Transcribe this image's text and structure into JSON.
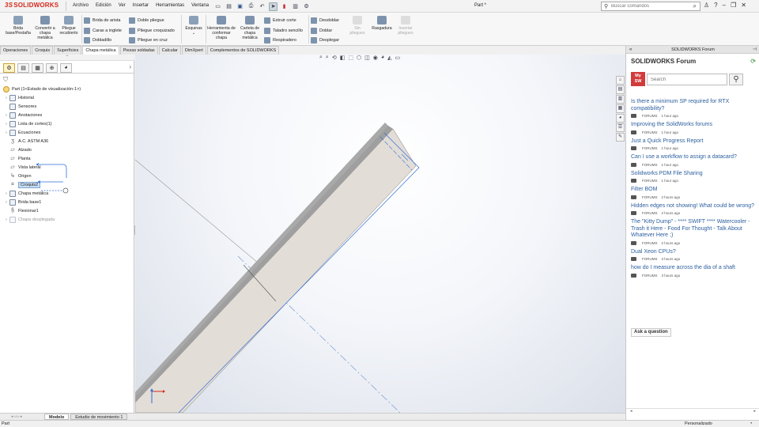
{
  "app": {
    "logo_prefix": "3S",
    "logo_text": "SOLIDWORKS",
    "doc_title": "Part *",
    "search_placeholder": "Buscar comandos"
  },
  "menu": [
    "Archivo",
    "Edición",
    "Ver",
    "Insertar",
    "Herramientas",
    "Ventana"
  ],
  "ribbon": {
    "brida_base": "Brida base/Pestaña",
    "convertir": "Convertir a chapa metálica",
    "pliegue_recubierto": "Pliegue recubierto",
    "brida_arista": "Brida de arista",
    "caras_inglete": "Caras a inglete",
    "dobladillo": "Dobladillo",
    "doble_pliegue": "Doble pliegue",
    "pliegue_croquizado": "Pliegue croquizado",
    "pliegue_cruz": "Pliegue en cruz",
    "esquinas": "Esquinas",
    "herramienta_conformar": "Herramienta de conformar chapa",
    "cartela": "Cartela de chapa metálica",
    "extruir_corte": "Extruir corte",
    "taladro_sencillo": "Taladro sencillo",
    "respiradero": "Respiradero",
    "desdoblar": "Desdoblar",
    "doblar": "Doblar",
    "desplegar": "Desplegar",
    "sin_pliegues": "Sin pliegues",
    "rasgadura": "Rasgadura",
    "insertar_pliegues": "Insertar pliegues"
  },
  "command_tabs": [
    "Operaciones",
    "Croquis",
    "Superficies",
    "Chapa metálica",
    "Piezas soldadas",
    "Calcular",
    "DimXpert",
    "Complementos de SOLIDWORKS"
  ],
  "tree": {
    "root": "Part  (1<Estado de visualización-1>)",
    "items": [
      {
        "label": "Historial",
        "expand": true
      },
      {
        "label": "Sensores",
        "expand": false
      },
      {
        "label": "Anotaciones",
        "expand": true
      },
      {
        "label": "Lista de cortes(1)",
        "expand": true
      },
      {
        "label": "Ecuaciones",
        "expand": true
      },
      {
        "label": "A.C. ASTM A36",
        "expand": false
      },
      {
        "label": "Alzado",
        "expand": false
      },
      {
        "label": "Planta",
        "expand": false
      },
      {
        "label": "Vista lateral",
        "expand": false
      },
      {
        "label": "Origen",
        "expand": false
      },
      {
        "label": "Croquis2",
        "expand": false
      },
      {
        "label": "Chapa metálica",
        "expand": true
      },
      {
        "label": "Brida base1",
        "expand": true
      },
      {
        "label": "Flexionar1",
        "expand": false
      },
      {
        "label": "Chapa desplegada",
        "expand": true
      }
    ]
  },
  "bottom_tabs": [
    "Modelo",
    "Estudio de movimiento 1"
  ],
  "status": {
    "left": "Part",
    "right": "Personalizado"
  },
  "taskpane": {
    "header": "SOLIDWORKS Forum",
    "title": "SOLIDWORKS Forum",
    "logo_line1": "My",
    "logo_line2": "SW",
    "search_placeholder": "Search",
    "ask_button": "Ask a question",
    "posts": [
      {
        "title": "Is there a minimum SP required for RTX compatibility?",
        "source": "FORUMS",
        "time": "1 hour ago"
      },
      {
        "title": "Improving the SolidWorks forums",
        "source": "FORUMS",
        "time": "1 hour ago"
      },
      {
        "title": "Just a Quick Progress Report",
        "source": "FORUMS",
        "time": "1 hour ago"
      },
      {
        "title": "Can I use a workflow to assign a datacard?",
        "source": "FORUMS",
        "time": "1 hour ago"
      },
      {
        "title": "Solidworks PDM File Sharing",
        "source": "FORUMS",
        "time": "1 hour ago"
      },
      {
        "title": "Filter BOM",
        "source": "FORUMS",
        "time": "2 hours ago"
      },
      {
        "title": "Hidden edges not showing! What could be wrong?",
        "source": "FORUMS",
        "time": "2 hours ago"
      },
      {
        "title": "The \"Kitty Dump\" - **** SWIFT **** Watercooler - Trash it Here - Food For Thought - Talk About Whatever Here ;)",
        "source": "FORUMS",
        "time": "2 hours ago"
      },
      {
        "title": "Dual Xeon CPUs?",
        "source": "FORUMS",
        "time": "3 hours ago"
      },
      {
        "title": "how do I measure across the dia of a shaft",
        "source": "FORUMS",
        "time": "3 hours ago"
      }
    ]
  },
  "colors": {
    "brand_red": "#d42a1d",
    "link_blue": "#2c5f9e",
    "part_face": "#e2ddd8",
    "sketch_blue": "#2f6fd6"
  }
}
